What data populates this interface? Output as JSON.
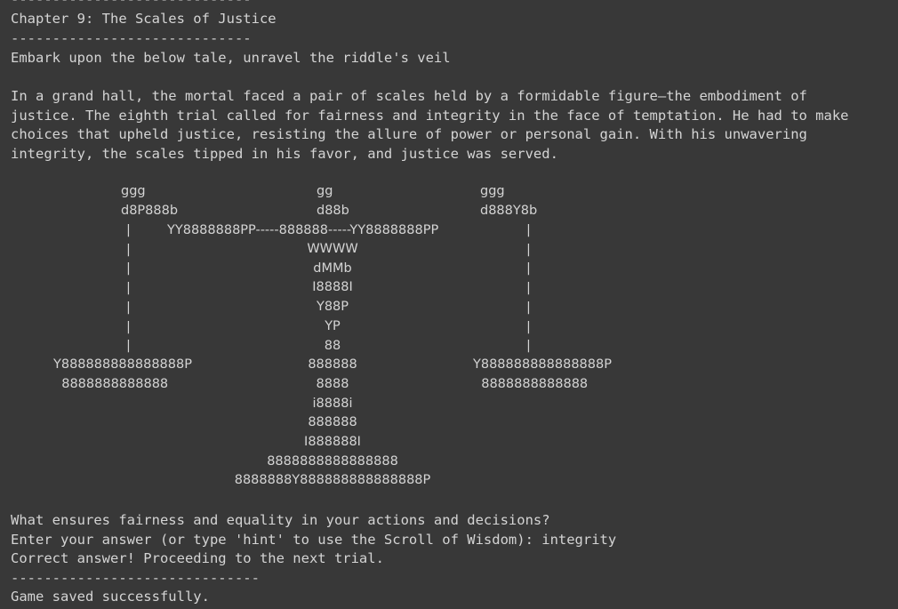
{
  "output": {
    "top_rule": "-----------------------------",
    "chapter_title": "Chapter 9: The Scales of Justice",
    "title_rule": "-----------------------------",
    "intro": "Embark upon the below tale, unravel the riddle's veil",
    "story_lines": [
      "In a grand hall, the mortal faced a pair of scales held by a formidable figure—the embodiment of",
      "justice. The eighth trial called for fairness and integrity in the face of temptation. He had to make",
      "choices that upheld justice, resisting the allure of power or personal gain. With his unwavering",
      "integrity, the scales tipped in his favor, and justice was served."
    ],
    "question": "What ensures fairness and equality in your actions and decisions?",
    "prompt": "Enter your answer (or type 'hint' to use the Scroll of Wisdom): integrity",
    "result": "Correct answer! Proceeding to the next trial.",
    "end_rule": "------------------------------",
    "save_status": "Game saved successfully."
  },
  "ascii_art": {
    "left_top": "ggg\nd8P888b",
    "center_top": "gg\nd88b",
    "right_top": "ggg\nd888Y8b",
    "beam": "YY8888888PP-----888888-----YY8888888PP",
    "left_chain": "|\n|\n|\n|\n|\n|\n|",
    "right_chain": "|\n|\n|\n|\n|\n|\n|",
    "left_pan": "Y888888888888888P\n  8888888888888",
    "right_pan": "Y888888888888888P\n  8888888888888",
    "pillar": "WWWW\ndMMb\nI8888I\nY88P\nYP\n88\n888888\n8888\ni8888i\n888888\nI888888I\n8888888888888888\n8888888Y888888888888888P"
  }
}
